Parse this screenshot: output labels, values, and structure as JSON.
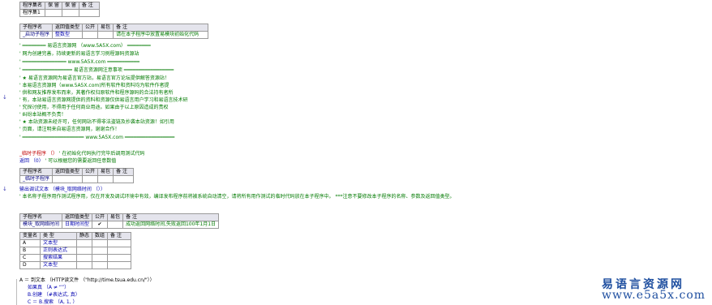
{
  "program_table": {
    "headers": [
      "程序集名",
      "保 留",
      "保 留",
      "备 注"
    ],
    "row": [
      "程序集1",
      "",
      "",
      ""
    ]
  },
  "sub_table_1": {
    "headers": [
      "子程序名",
      "返回值类型",
      "公开",
      "易包",
      "备 注"
    ],
    "row": [
      "_启动子程序",
      "整数型",
      "",
      "",
      "请在本子程序中放置易模块初始化代码"
    ]
  },
  "comment_block": [
    "' ━━━━━━━━  易语言资源网 （www.5A5X.com） ━━━━━━━━",
    "' 网为创建完善，持续更新的易语言学习例程源码资源站",
    "' ━━━━━━━━━━━━━━━   www.5A5X.com  ━━━━━━━━━━━",
    "' ━━━━━━━━━━━━━━━━━   易语言资源网注意事项  ━━━━━━━━━━━━━━━━━",
    "' ★ 易语言资源网为易语言官方站，易语言官方论坛提供解答资源站！",
    "' 本易语言资源网（www.5A5X.com)所有软件和资料均为软件作者提",
    "' 供和网友推荐发布而来，其著作权归原软件和程序源码的合法持有者所",
    "' 有，本站易语言资源网提供的资料和资源仅供易语言用户学习和易语言技术研",
    "' 究探讨使用，不得用于任何商业用途。如果由于以上原因造成的责权",
    "' 纠纷本站概不负责！",
    "' ★ 本站资源未经许可，任何网站不得非法盗链及抄袭本站资源！如引用",
    "' 页面，请注明来自易语言资源网，谢谢合作！",
    "' ━━━━━━━━━━━━━━━━━━━━━   www.5A5X.com  ━━━━━━━━━━━━━━━━━"
  ],
  "temp_sub_line": {
    "name": "_临时子程序 （）",
    "comment": "' 在初始化代码执行完毕后调用测试代码"
  },
  "return_line": {
    "code": "返回 （0）",
    "comment": "' 可以根据您的需要返回任意数值"
  },
  "sub_table_2": {
    "headers": [
      "子程序名",
      "返回值类型",
      "公开",
      "易包",
      "备 注"
    ],
    "row": [
      "_临时子程序",
      "",
      "",
      "",
      ""
    ]
  },
  "debug_line": {
    "code": "输出调试文本 （模块_取网络时间 （））"
  },
  "note_line": {
    "text": "' 本名称子程序用作测试程序用，仅在开发及调试环境中有效，编译发布程序前将被系统自动清空，请将所有用作测试的临时代码放在本子程序中。 ***注意不要修改本子程序的名称、参数及返回值类型。"
  },
  "sub_table_3": {
    "headers": [
      "子程序名",
      "返回值类型",
      "公开",
      "易包",
      "备 注"
    ],
    "row": [
      "模块_取网络时间",
      "日期时间型",
      "✔",
      "",
      "成功返回网络时间,失败返回100年1月1日"
    ]
  },
  "var_table": {
    "headers": [
      "变量名",
      "类 型",
      "静态",
      "数组",
      "备 注"
    ],
    "rows": [
      [
        "A",
        "文本型",
        "",
        "",
        ""
      ],
      [
        "B",
        "正则表达式",
        "",
        "",
        ""
      ],
      [
        "C",
        "搜索结果",
        "",
        "",
        ""
      ],
      [
        "D",
        "文本型",
        "",
        "",
        ""
      ]
    ]
  },
  "code_lines": [
    "A ＝ 到文本 （HTTP读文件 （\"http://time.tsua.edu.cn/\"））",
    "如果真 （A ≠ “”）",
    "B.创建 （#表达式, 真）",
    "C ＝ B.搜索 （A, 1, ）"
  ],
  "watermark": {
    "line1": "易语言资源网",
    "line2": "www.e5a5x.com"
  }
}
